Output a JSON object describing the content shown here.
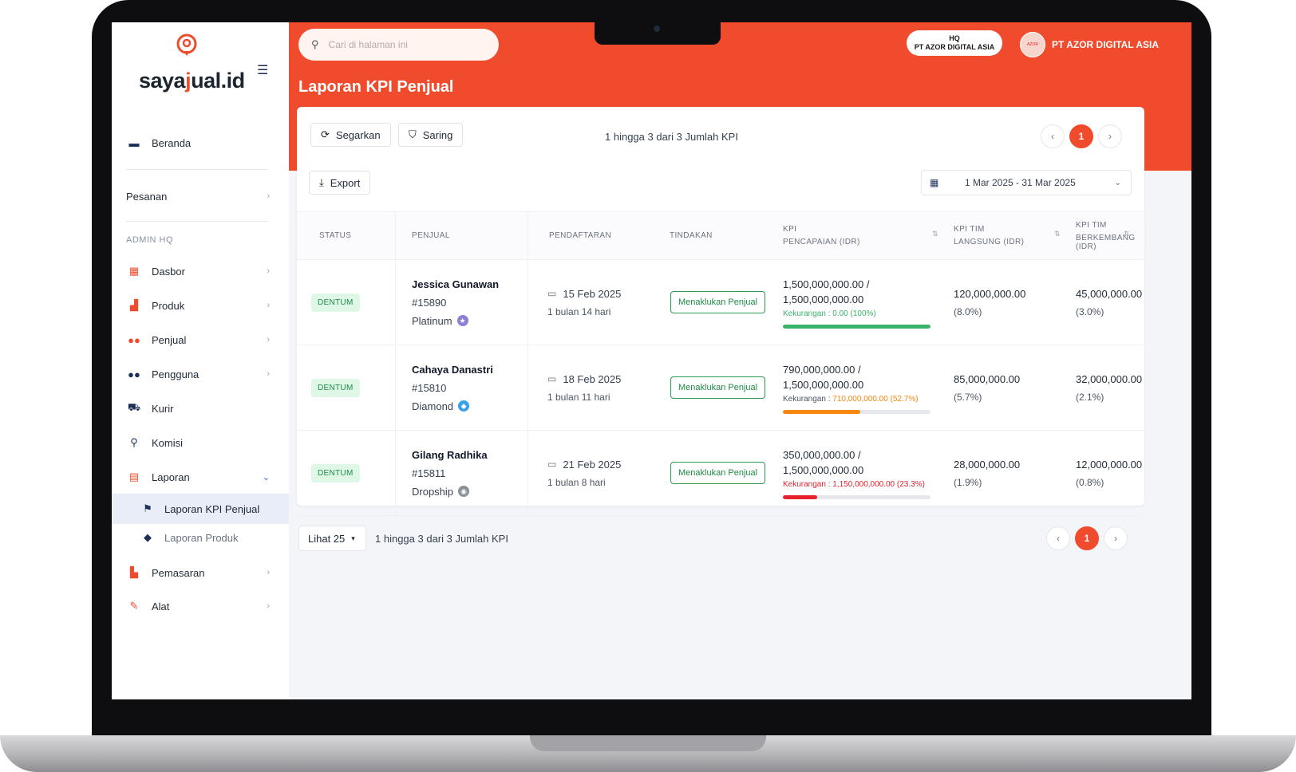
{
  "app": {
    "logo_text_a": "saya",
    "logo_text_o": "j",
    "logo_text_b": "ual.id"
  },
  "sidebar": {
    "home": {
      "label": "Beranda",
      "icon": "card-icon"
    },
    "orders": {
      "label": "Pesanan"
    },
    "section_title": "ADMIN HQ",
    "items": [
      {
        "label": "Dasbor",
        "icon": "dashboard-icon"
      },
      {
        "label": "Produk",
        "icon": "product-icon"
      },
      {
        "label": "Penjual",
        "icon": "seller-icon"
      },
      {
        "label": "Pengguna",
        "icon": "users-icon"
      },
      {
        "label": "Kurir",
        "icon": "courier-icon"
      },
      {
        "label": "Komisi",
        "icon": "commission-icon"
      },
      {
        "label": "Laporan",
        "icon": "report-icon"
      }
    ],
    "sub_items": [
      {
        "label": "Laporan KPI Penjual",
        "icon": "flag-icon"
      },
      {
        "label": "Laporan Produk",
        "icon": "tag-icon"
      }
    ],
    "bottom_items": [
      {
        "label": "Pemasaran",
        "icon": "marketing-icon"
      },
      {
        "label": "Alat",
        "icon": "wrench-icon"
      }
    ]
  },
  "header": {
    "search_placeholder": "Cari di halaman ini",
    "hq_line1": "HQ",
    "hq_line2": "PT AZOR DIGITAL ASIA",
    "company_name": "PT AZOR DIGITAL ASIA",
    "page_title": "Laporan KPI Penjual"
  },
  "toolbar": {
    "refresh_label": "Segarkan",
    "filter_label": "Saring",
    "export_label": "Export",
    "count_text": "1 hingga 3 dari 3 Jumlah KPI",
    "current_page": "1",
    "date_range": "1 Mar 2025 - 31 Mar 2025"
  },
  "table": {
    "headers": {
      "status": "STATUS",
      "seller": "PENJUAL",
      "registration": "PENDAFTARAN",
      "action": "TINDAKAN",
      "kpi_line1": "KPI",
      "kpi_line2": "PENCAPAIAN (IDR)",
      "team_direct_line1": "KPI TIM",
      "team_direct_line2": "LANGSUNG (IDR)",
      "team_dev_line1": "KPI TIM",
      "team_dev_line2": "BERKEMBANG (IDR)"
    },
    "rows": [
      {
        "status": "DENTUM",
        "name": "Jessica Gunawan",
        "id": "#15890",
        "tier": "Platinum",
        "date": "15 Feb 2025",
        "duration": "1 bulan 14 hari",
        "action": "Menaklukan Penjual",
        "kpi_line1": "1,500,000,000.00 /",
        "kpi_line2": "1,500,000,000.00",
        "shortfall_label": "Kekurangan : ",
        "shortfall_value": "0.00 (100%)",
        "progress": 1.0,
        "bar_color": "#3ab36a",
        "note_color": "#3ab36a",
        "label_color": "#3ab36a",
        "team_direct": "120,000,000.00",
        "team_direct_pct": "(8.0%)",
        "team_dev": "45,000,000.00",
        "team_dev_pct": "(3.0%)"
      },
      {
        "status": "DENTUM",
        "name": "Cahaya Danastri",
        "id": "#15810",
        "tier": "Diamond",
        "date": "18 Feb 2025",
        "duration": "1 bulan 11 hari",
        "action": "Menaklukan Penjual",
        "kpi_line1": "790,000,000.00 /",
        "kpi_line2": "1,500,000,000.00",
        "shortfall_label": "Kekurangan : ",
        "shortfall_value": "710,000,000.00 (52.7%)",
        "progress": 0.527,
        "bar_color": "#f7870e",
        "note_color": "#f7870e",
        "label_color": "#4b5563",
        "team_direct": "85,000,000.00",
        "team_direct_pct": "(5.7%)",
        "team_dev": "32,000,000.00",
        "team_dev_pct": "(2.1%)"
      },
      {
        "status": "DENTUM",
        "name": "Gilang Radhika",
        "id": "#15811",
        "tier": "Dropship",
        "date": "21 Feb 2025",
        "duration": "1 bulan 8 hari",
        "action": "Menaklukan Penjual",
        "kpi_line1": "350,000,000.00 /",
        "kpi_line2": "1,500,000,000.00",
        "shortfall_label": "Kekurangan : ",
        "shortfall_value": "1,150,000,000.00 (23.3%)",
        "progress": 0.233,
        "bar_color": "#e8212f",
        "note_color": "#e8212f",
        "label_color": "#e8212f",
        "team_direct": "28,000,000.00",
        "team_direct_pct": "(1.9%)",
        "team_dev": "12,000,000.00",
        "team_dev_pct": "(0.8%)"
      }
    ]
  },
  "footer": {
    "page_size_label": "Lihat 25",
    "count_text": "1 hingga 3 dari 3 Jumlah KPI",
    "current_page": "1"
  },
  "colors": {
    "accent": "#f04b2d",
    "success": "#1f8a47"
  }
}
